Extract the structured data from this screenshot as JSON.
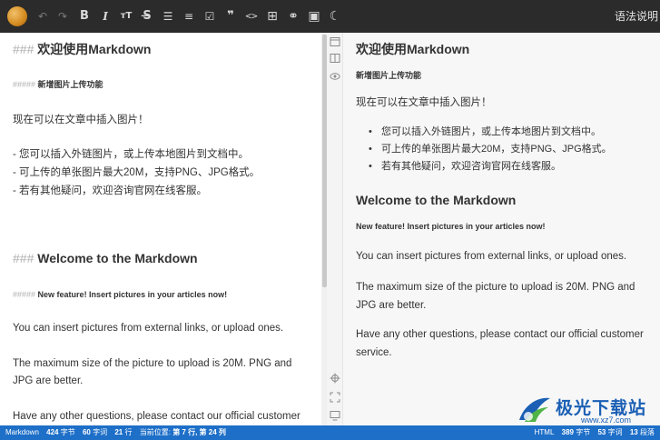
{
  "toolbar": {
    "items": [
      {
        "name": "undo-icon",
        "glyph": "↶"
      },
      {
        "name": "redo-icon",
        "glyph": "↷"
      },
      {
        "name": "bold-button",
        "glyph": "B"
      },
      {
        "name": "italic-button",
        "glyph": "I"
      },
      {
        "name": "heading-button",
        "glyph": "тT"
      },
      {
        "name": "strikethrough-button",
        "glyph": "S̶"
      },
      {
        "name": "unordered-list-icon",
        "glyph": "☰"
      },
      {
        "name": "ordered-list-icon",
        "glyph": "≡"
      },
      {
        "name": "task-list-icon",
        "glyph": "☑"
      },
      {
        "name": "quote-icon",
        "glyph": "❞"
      },
      {
        "name": "code-icon",
        "glyph": "<>"
      },
      {
        "name": "table-icon",
        "glyph": "⊞"
      },
      {
        "name": "link-icon",
        "glyph": "⚭"
      },
      {
        "name": "image-icon",
        "glyph": "▣"
      },
      {
        "name": "theme-toggle-icon",
        "glyph": "☾"
      }
    ],
    "right_label": "语法说明"
  },
  "editor": {
    "h3_cn": {
      "hash": "###",
      "text": "欢迎使用Markdown"
    },
    "h5_cn": {
      "hash": "#####",
      "text": "新增图片上传功能"
    },
    "p1": "现在可以在文章中插入图片！",
    "li1": "- 您可以插入外链图片，或上传本地图片到文档中。",
    "li2": "- 可上传的单张图片最大20M，支持PNG、JPG格式。",
    "li3": "- 若有其他疑问，欢迎咨询官网在线客服。",
    "h3_en": {
      "hash": "###",
      "text": "Welcome to the Markdown"
    },
    "h5_en": {
      "hash": "#####",
      "text": "New feature! Insert pictures in your articles now!"
    },
    "p2": "You can insert pictures from external links, or upload ones.",
    "p3a": "The maximum size of the picture to upload is 20M. PNG and",
    "p3b": "JPG are better.",
    "p4": "Have any other questions, please contact our official customer"
  },
  "preview": {
    "h3_cn": "欢迎使用Markdown",
    "h5_cn": "新增图片上传功能",
    "p1": "现在可以在文章中插入图片！",
    "list": [
      "您可以插入外链图片，或上传本地图片到文档中。",
      "可上传的单张图片最大20M，支持PNG、JPG格式。",
      "若有其他疑问，欢迎咨询官网在线客服。"
    ],
    "h3_en": "Welcome to the Markdown",
    "h5_en": "New feature! Insert pictures in your articles now!",
    "p2": "You can insert pictures from external links, or upload ones.",
    "p3": "The maximum size of the picture to upload is 20M. PNG and JPG are better.",
    "p4": "Have any other questions, please contact our official customer service."
  },
  "statusbar": {
    "left": {
      "mode": "Markdown",
      "bytes_value": "424",
      "bytes_unit": "字节",
      "words_value": "60",
      "words_unit": "字词",
      "lines_value": "21",
      "lines_unit": "行",
      "position_label": "当前位置:",
      "position_line": "第 7 行,",
      "position_col": "第 24 列"
    },
    "right": {
      "mode": "HTML",
      "bytes_value": "389",
      "bytes_unit": "字节",
      "words_value": "53",
      "words_unit": "字词",
      "paragraphs_value": "13",
      "paragraphs_unit": "段落"
    }
  },
  "watermark": {
    "text": "极光下载站",
    "url": "www.xz7.com"
  },
  "colors": {
    "toolbar_bg": "#2b2b2b",
    "statusbar_bg": "#1e6fc8",
    "preview_bg": "#f7f7f7",
    "watermark": "#1a5fb4"
  }
}
